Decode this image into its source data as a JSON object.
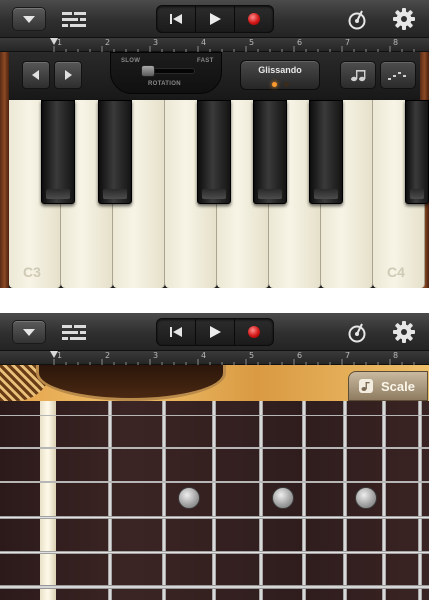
{
  "keyboard_view": {
    "toolbar": {
      "menu": "down-triangle-icon",
      "tracks": "tracks-list-icon",
      "transport": [
        "rewind-icon",
        "play-icon",
        "record-icon"
      ],
      "metronome": "metronome-icon",
      "settings": "gear-icon",
      "colors": {
        "record": "#d11616"
      }
    },
    "ruler": {
      "marks": [
        "1",
        "2",
        "3",
        "4",
        "5",
        "6",
        "7",
        "8"
      ]
    },
    "controls": {
      "octave_left": "left-arrow-icon",
      "octave_right": "right-arrow-icon",
      "rotation": {
        "slow": "SLOW",
        "fast": "FAST",
        "label": "ROTATION",
        "level": 0.05
      },
      "glissando": {
        "label": "Glissando",
        "led_on": "#ff9a2e",
        "led_off": "#3a2a1a"
      },
      "note_button": "eighth-note-icon",
      "arpeggio_button": "arpeggio-icon"
    },
    "keys": {
      "low_label": "C3",
      "high_label": "C4"
    }
  },
  "guitar_view": {
    "toolbar": {
      "menu": "down-triangle-icon",
      "tracks": "tracks-list-icon",
      "transport": [
        "rewind-icon",
        "play-icon",
        "record-icon"
      ],
      "metronome": "metronome-icon",
      "settings": "gear-icon"
    },
    "ruler": {
      "marks": [
        "1",
        "2",
        "3",
        "4",
        "5",
        "6",
        "7",
        "8"
      ]
    },
    "scale_button": {
      "label": "Scale",
      "icon": "music-note-icon"
    },
    "fretboard": {
      "strings": 6,
      "inlay_frets": [
        3,
        5,
        7
      ]
    }
  }
}
